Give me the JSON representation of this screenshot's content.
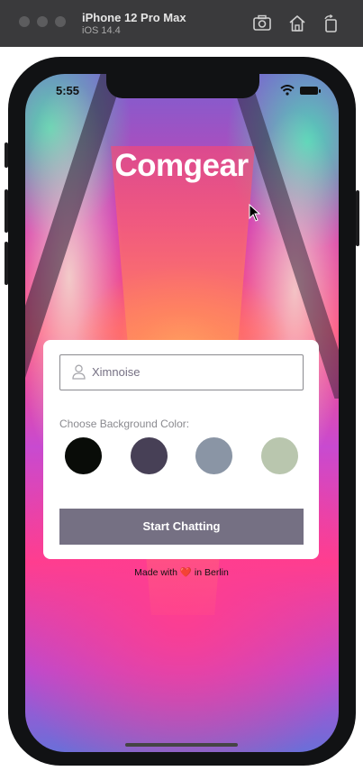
{
  "simulator": {
    "device_name": "iPhone 12 Pro Max",
    "os_version": "iOS 14.4",
    "icons": [
      "screenshot-icon",
      "home-icon",
      "rotate-icon"
    ]
  },
  "status_bar": {
    "time": "5:55",
    "icons": [
      "wifi-icon",
      "battery-icon"
    ]
  },
  "app": {
    "title": "Comgear"
  },
  "form": {
    "name_value": "Ximnoise",
    "name_icon": "person-icon",
    "choose_label": "Choose Background Color:",
    "color_options": [
      {
        "name": "black",
        "hex": "#090C08"
      },
      {
        "name": "dark-purple",
        "hex": "#474056"
      },
      {
        "name": "gray-purple",
        "hex": "#8A95A5"
      },
      {
        "name": "light-gray",
        "hex": "#B9C6AE"
      }
    ],
    "start_label": "Start Chatting"
  },
  "footer": {
    "made_with": "Made with",
    "heart": "❤️",
    "in_city": "in Berlin"
  },
  "colors": {
    "button": "#757083",
    "card": "#FFFFFF",
    "title": "#FFFFFF"
  }
}
